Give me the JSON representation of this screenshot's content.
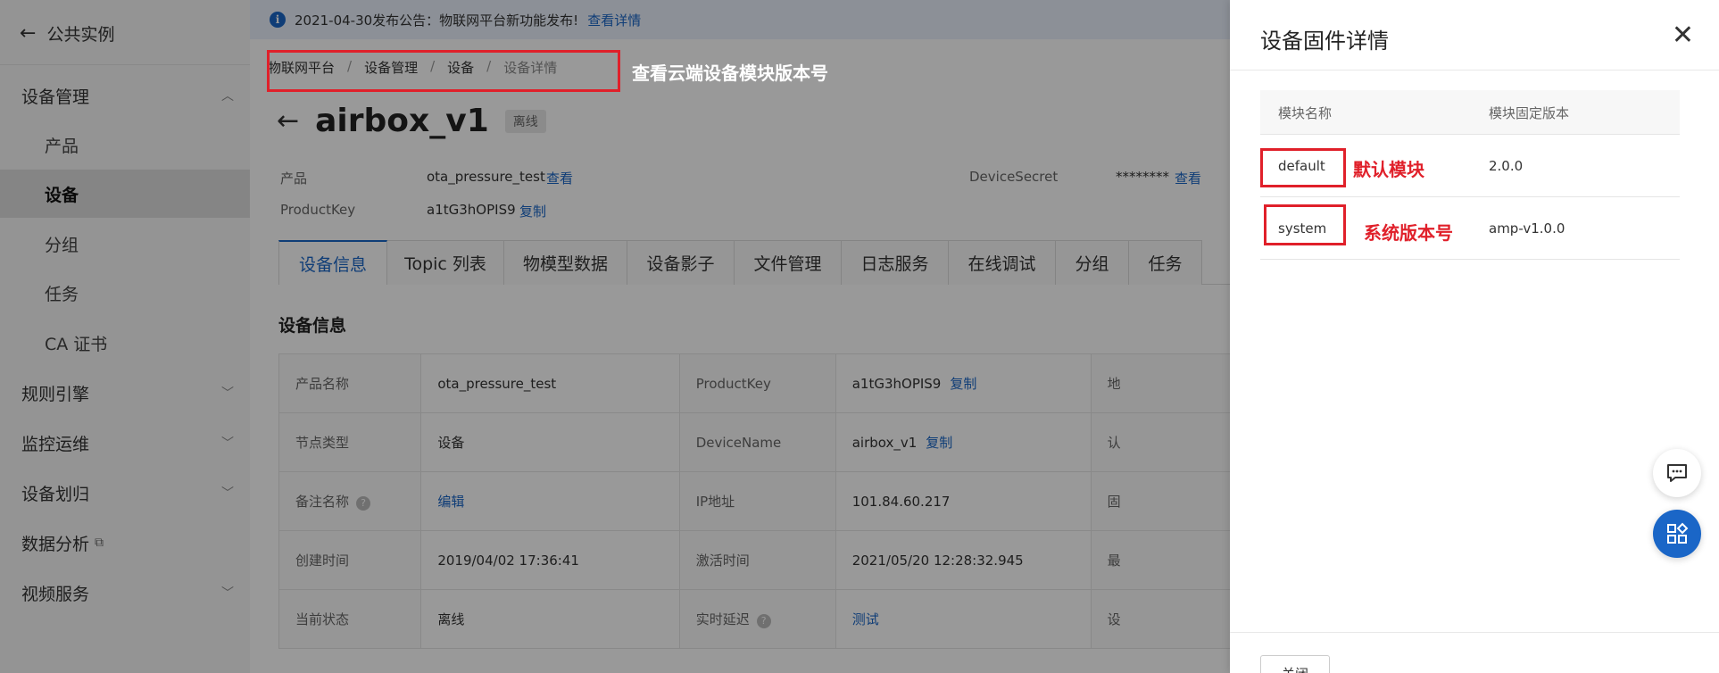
{
  "sidebar": {
    "back_label": "公共实例",
    "items": [
      {
        "label": "设备管理"
      },
      {
        "label": "产品"
      },
      {
        "label": "设备"
      },
      {
        "label": "分组"
      },
      {
        "label": "任务"
      },
      {
        "label": "CA 证书"
      },
      {
        "label": "规则引擎"
      },
      {
        "label": "监控运维"
      },
      {
        "label": "设备划归"
      },
      {
        "label": "数据分析"
      },
      {
        "label": "视频服务"
      }
    ]
  },
  "announcement": {
    "text": "2021-04-30发布公告：物联网平台新功能发布!",
    "link": "查看详情"
  },
  "breadcrumb": [
    "物联网平台",
    "设备管理",
    "设备",
    "设备详情"
  ],
  "annotations": {
    "breadcrumb_note": "查看云端设备模块版本号",
    "default_note": "默认模块",
    "system_note": "系统版本号"
  },
  "device": {
    "name": "airbox_v1",
    "status_badge": "离线",
    "product_label": "产品",
    "product_value": "ota_pressure_test",
    "view_link": "查看",
    "productkey_label": "ProductKey",
    "productkey_value": "a1tG3hOPIS9",
    "copy_link": "复制",
    "devicesecret_label": "DeviceSecret",
    "devicesecret_value": "********",
    "view_link2": "查看"
  },
  "tabs": [
    "设备信息",
    "Topic 列表",
    "物模型数据",
    "设备影子",
    "文件管理",
    "日志服务",
    "在线调试",
    "分组",
    "任务"
  ],
  "section_title": "设备信息",
  "info_rows": [
    {
      "l1": "产品名称",
      "v1": "ota_pressure_test",
      "l2": "ProductKey",
      "v2": "a1tG3hOPIS9",
      "v2_link": "复制",
      "l3": "地"
    },
    {
      "l1": "节点类型",
      "v1": "设备",
      "l2": "DeviceName",
      "v2": "airbox_v1",
      "v2_link": "复制",
      "l3": "认"
    },
    {
      "l1": "备注名称",
      "v1_link": "编辑",
      "l2": "IP地址",
      "v2": "101.84.60.217",
      "l3": "固"
    },
    {
      "l1": "创建时间",
      "v1": "2019/04/02 17:36:41",
      "l2": "激活时间",
      "v2": "2021/05/20 12:28:32.945",
      "l3": "最"
    },
    {
      "l1": "当前状态",
      "v1": "离线",
      "l2": "实时延迟",
      "v2_link": "测试",
      "l3": "设"
    }
  ],
  "drawer": {
    "title": "设备固件详情",
    "col_module": "模块名称",
    "col_version": "模块固定版本",
    "rows": [
      {
        "module": "default",
        "version": "2.0.0"
      },
      {
        "module": "system",
        "version": "amp-v1.0.0"
      }
    ],
    "footer_button": "关闭"
  },
  "colors": {
    "accent": "#1a66c7",
    "annotation_red": "#e0202a"
  }
}
